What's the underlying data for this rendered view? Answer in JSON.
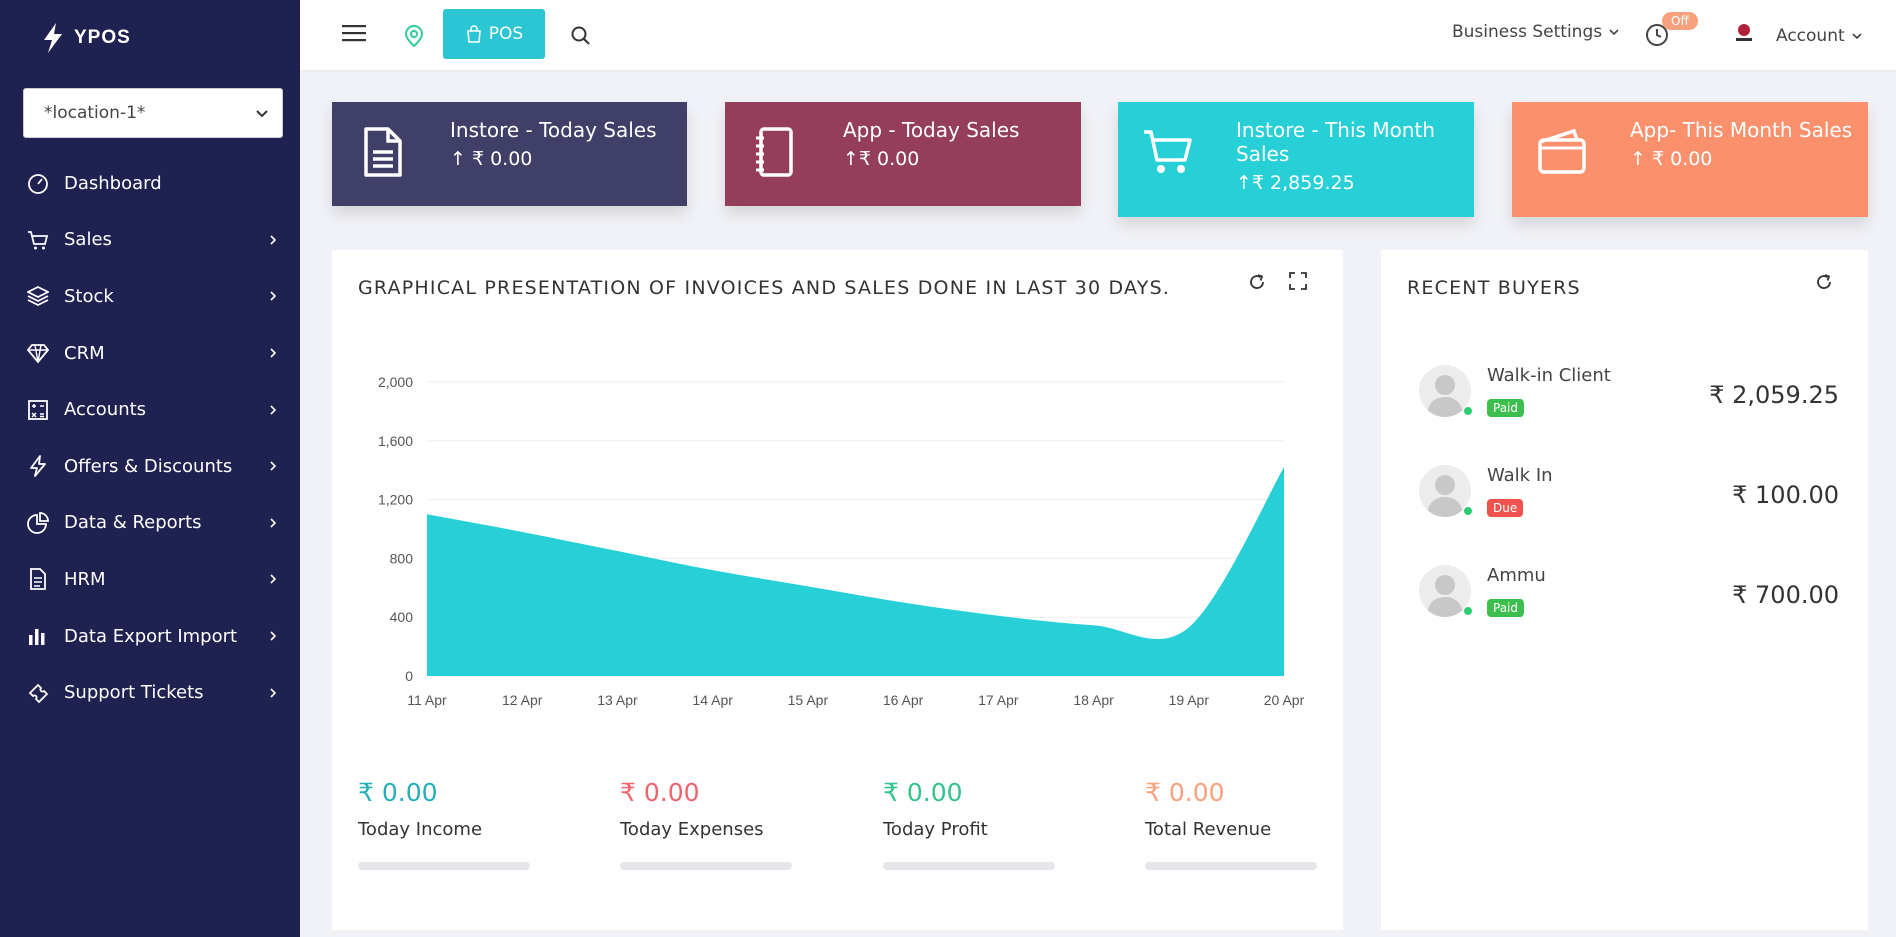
{
  "app": {
    "brand": "YPOS"
  },
  "sidebar": {
    "location_select": "*location-1*",
    "items": [
      {
        "label": "Dashboard",
        "icon": "dashboard-gauge-icon",
        "has_arrow": false
      },
      {
        "label": "Sales",
        "icon": "cart-icon",
        "has_arrow": true
      },
      {
        "label": "Stock",
        "icon": "layers-icon",
        "has_arrow": true
      },
      {
        "label": "CRM",
        "icon": "diamond-icon",
        "has_arrow": true
      },
      {
        "label": "Accounts",
        "icon": "calculator-icon",
        "has_arrow": true
      },
      {
        "label": "Offers & Discounts",
        "icon": "bolt-icon",
        "has_arrow": true
      },
      {
        "label": "Data & Reports",
        "icon": "pie-chart-icon",
        "has_arrow": true
      },
      {
        "label": "HRM",
        "icon": "document-icon",
        "has_arrow": true
      },
      {
        "label": "Data Export Import",
        "icon": "bar-chart-icon",
        "has_arrow": true
      },
      {
        "label": "Support Tickets",
        "icon": "ticket-icon",
        "has_arrow": true
      }
    ]
  },
  "topbar": {
    "pos_label": "POS",
    "business_settings": "Business Settings",
    "clock_badge": "Off",
    "account": "Account"
  },
  "stats": [
    {
      "title": "Instore - Today Sales",
      "value": "↑ ₹ 0.00",
      "color": "#3f3f68",
      "icon": "document-icon"
    },
    {
      "title": "App - Today Sales",
      "value": "↑₹ 0.00",
      "color": "#943e5c",
      "icon": "notebook-icon"
    },
    {
      "title": "Instore - This Month Sales",
      "value": "↑₹ 2,859.25",
      "color": "#27d0d6",
      "icon": "cart-icon"
    },
    {
      "title": "App- This Month Sales",
      "value": "↑ ₹ 0.00",
      "color": "#fb916c",
      "icon": "wallet-icon"
    }
  ],
  "chart_panel": {
    "title": "GRAPHICAL PRESENTATION OF INVOICES AND SALES DONE IN LAST 30 DAYS."
  },
  "chart_data": {
    "type": "area",
    "title": "GRAPHICAL PRESENTATION OF INVOICES AND SALES DONE IN LAST 30 DAYS.",
    "x": [
      "11 Apr",
      "12 Apr",
      "13 Apr",
      "14 Apr",
      "15 Apr",
      "16 Apr",
      "17 Apr",
      "18 Apr",
      "19 Apr",
      "20 Apr"
    ],
    "series": [
      {
        "values": [
          1100,
          980,
          850,
          720,
          610,
          500,
          410,
          345,
          330,
          1420
        ]
      }
    ],
    "yticks": [
      0,
      400,
      800,
      1200,
      1600,
      2000
    ],
    "ylim": [
      0,
      2000
    ],
    "grid": true,
    "color": "#27d0d6"
  },
  "kpis": [
    {
      "value": "₹ 0.00",
      "label": "Today Income",
      "color": "#27aeb9"
    },
    {
      "value": "₹ 0.00",
      "label": "Today Expenses",
      "color": "#f0656d"
    },
    {
      "value": "₹ 0.00",
      "label": "Today Profit",
      "color": "#35c28b"
    },
    {
      "value": "₹ 0.00",
      "label": "Total Revenue",
      "color": "#f7a17d"
    }
  ],
  "recent_buyers": {
    "title": "RECENT BUYERS",
    "items": [
      {
        "name": "Walk-in Client",
        "status": "Paid",
        "amount": "₹ 2,059.25"
      },
      {
        "name": "Walk In",
        "status": "Due",
        "amount": "₹ 100.00"
      },
      {
        "name": "Ammu",
        "status": "Paid",
        "amount": "₹ 700.00"
      }
    ]
  }
}
